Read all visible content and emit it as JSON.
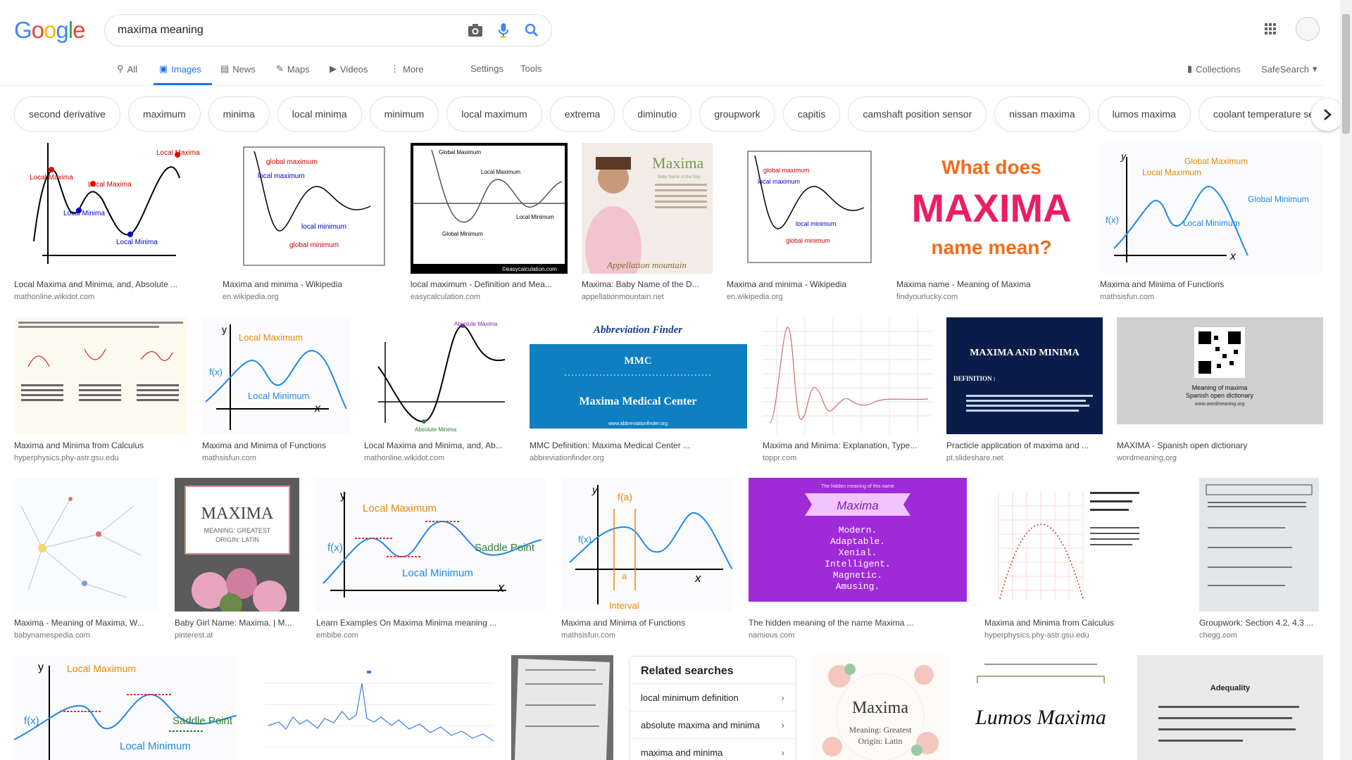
{
  "header": {
    "logo": "Google",
    "query": "maxima meaning",
    "colors": {
      "blue": "#4285F4",
      "red": "#EA4335",
      "yellow": "#FBBC05",
      "green": "#34A853"
    }
  },
  "tabs": {
    "all": "All",
    "images": "Images",
    "news": "News",
    "maps": "Maps",
    "videos": "Videos",
    "more": "More",
    "settings": "Settings",
    "tools": "Tools",
    "collections": "Collections",
    "safesearch": "SafeSearch"
  },
  "chips": [
    "second derivative",
    "maximum",
    "minima",
    "local minima",
    "minimum",
    "local maximum",
    "extrema",
    "diminutio",
    "groupwork",
    "capitis",
    "camshaft position sensor",
    "nissan maxima",
    "lumos maxima",
    "coolant temperature sensor"
  ],
  "results": [
    {
      "caption": "Local Maxima and Minima, and, Absolute ...",
      "source": "mathonline.wikidot.com"
    },
    {
      "caption": "Maxima and minima - Wikipedia",
      "source": "en.wikipedia.org"
    },
    {
      "caption": "local maximum - Definition and Mea...",
      "source": "easycalculation.com"
    },
    {
      "caption": "Maxima: Baby Name of the D...",
      "source": "appellationmountain.net"
    },
    {
      "caption": "Maxima and minima - Wikipedia",
      "source": "en.wikipedia.org"
    },
    {
      "caption": "Maxima name - Meaning of Maxima",
      "source": "findyourlucky.com"
    },
    {
      "caption": "Maxima and Minima of Functions",
      "source": "mathsisfun.com"
    },
    {
      "caption": "Maxima and Minima from Calculus",
      "source": "hyperphysics.phy-astr.gsu.edu"
    },
    {
      "caption": "Maxima and Minima of Functions",
      "source": "mathsisfun.com"
    },
    {
      "caption": "Local Maxima and Minima, and, Ab...",
      "source": "mathonline.wikidot.com"
    },
    {
      "caption": "MMC Definition: Maxima Medical Center ...",
      "source": "abbreviationfinder.org"
    },
    {
      "caption": "Maxima and Minima: Explanation, Type...",
      "source": "toppr.com"
    },
    {
      "caption": "Practicle application of maxima and ...",
      "source": "pt.slideshare.net"
    },
    {
      "caption": "MAXIMA - Spanish open dictionary",
      "source": "wordmeaning.org"
    },
    {
      "caption": "Maxima - Meaning of Maxima, W...",
      "source": "babynamespedia.com"
    },
    {
      "caption": "Baby Girl Name: Maxima. | M...",
      "source": "pinterest.at"
    },
    {
      "caption": "Learn Examples On Maxima Minima meaning ...",
      "source": "embibe.com"
    },
    {
      "caption": "Maxima and Minima of Functions",
      "source": "mathsisfun.com"
    },
    {
      "caption": "The hidden meaning of the name Maxima ...",
      "source": "namious.com"
    },
    {
      "caption": "Maxima and Minima from Calculus",
      "source": "hyperphysics.phy-astr.gsu.edu"
    },
    {
      "caption": "Groupwork: Section 4.2, 4.3 ...",
      "source": "chegg.com"
    }
  ],
  "imgtext": {
    "local_maxima": "Local Maxima",
    "local_minima": "Local Minima",
    "global_maximum": "global maximum",
    "local_maximum": "local maximum",
    "local_minimum": "local minimum",
    "global_minimum": "global minimum",
    "Global_Maximum": "Global Maximum",
    "Local_Maximum": "Local Maximum",
    "Global_Minimum": "Global Minimum",
    "Local_Minimum": "Local Minimum",
    "easycalc": "©easycalculation.com",
    "maxima_word": "Maxima",
    "baby_name_of_day": "Baby Name of the Day",
    "appellation_mountain": "Appellation mountain",
    "what_does": "What does",
    "maxima_caps": "MAXIMA",
    "name_mean": "name mean?",
    "fx": "f(x)",
    "x": "x",
    "y": "y",
    "abbrev_finder": "Abbreviation Finder",
    "mmc": "MMC",
    "maxima_medical_center": "Maxima Medical Center",
    "abbrev_url": "www.abbreviationfinder.org",
    "absolute_maxima": "Absolute Maxima",
    "absolute_minima": "Absolute Minima",
    "maxima_and_minima": "MAXIMA AND MINIMA",
    "definition": "DEFINITION :",
    "meaning_of_maxima": "Meaning of maxima",
    "spanish_open_dictionary": "Spanish open dictionary",
    "wordmeaning_url": "www.wordmeaning.org",
    "meaning_greatest": "MEANING: GREATEST",
    "origin_latin": "ORIGIN: LATIN",
    "saddle_point": "Saddle Point",
    "fa": "f(a)",
    "a": "a",
    "interval": "Interval",
    "hidden_meaning": "The hidden meaning of this name",
    "modern": "Modern.",
    "adaptable": "Adaptable.",
    "xenial": "Xenial.",
    "intelligent": "Intelligent.",
    "magnetic": "Magnetic.",
    "amusing": "Amusing.",
    "maxima_script": "Maxima",
    "meaning_greatest_lc": "Meaning: Greatest",
    "origin_latin_lc": "Origin: Latin",
    "lumos_maxima": "Lumos Maxima",
    "adequality": "Adequality"
  },
  "related": {
    "title": "Related searches",
    "items": [
      "local minimum definition",
      "absolute maxima and minima",
      "maxima and minima"
    ]
  }
}
